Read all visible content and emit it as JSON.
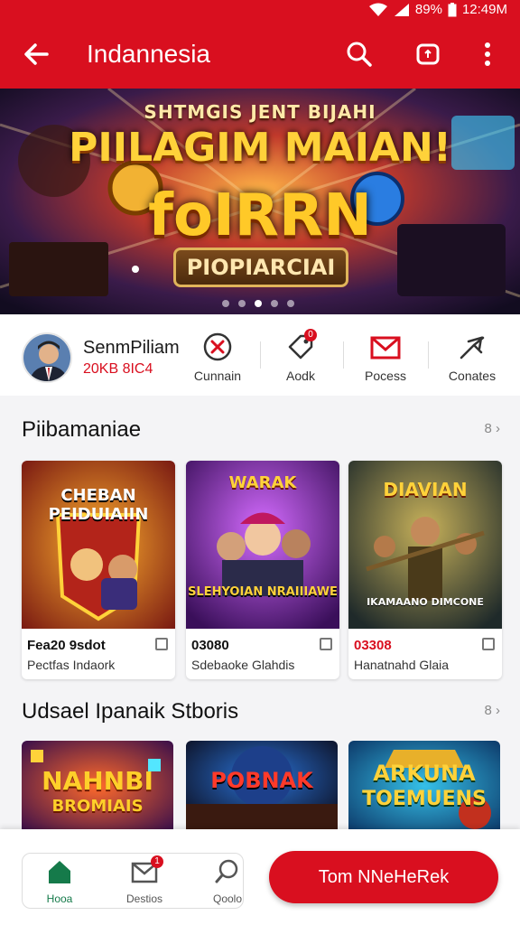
{
  "status_bar": {
    "battery": "89%",
    "time": "12:49M"
  },
  "app_bar": {
    "title": "Indannesia"
  },
  "banner": {
    "kicker": "SHTMGIS JENT BIJAHI",
    "title": "PIILAGIM MAIAN!",
    "logo": "foIRRN",
    "subtitle": "PIOPIARCIAI"
  },
  "profile": {
    "name": "SenmPiliam",
    "subtitle": "20KB 8IC4"
  },
  "quick_actions": [
    {
      "label": "Cunnain",
      "icon": "cancel-circle-icon"
    },
    {
      "label": "Aodk",
      "icon": "tag-icon",
      "badge": "0"
    },
    {
      "label": "Pocess",
      "icon": "mail-icon"
    },
    {
      "label": "Conates",
      "icon": "send-icon"
    }
  ],
  "section1": {
    "title": "Piibamaniae",
    "more": "8",
    "cards": [
      {
        "art_title": "CHEBAN PEIDUIAIIN",
        "line1": "Fea20 9sdot",
        "line2": "Pectfas Indaork"
      },
      {
        "art_title": "WARAK",
        "art_sub": "SLEHYOIAN NRAIIIAWE",
        "line1": "03080",
        "line2": "Sdebaoke Glahdis"
      },
      {
        "art_title": "DIAVIAN",
        "art_sub": "IKAMAANO DIMCONE",
        "line1": "03308",
        "line2": "Hanatnahd Glaia"
      }
    ]
  },
  "section2": {
    "title": "Udsael Ipanaik Stboris",
    "more": "8",
    "cards": [
      {
        "art_title": "NAHNBI",
        "art_sub": "BROMIAIS"
      },
      {
        "art_title": "POBNAK"
      },
      {
        "art_title": "ARKUNA",
        "art_sub": "TOEMUENS"
      }
    ]
  },
  "bottom_nav": {
    "items": [
      {
        "label": "Hooa",
        "icon": "home-icon"
      },
      {
        "label": "Destios",
        "icon": "mail-icon",
        "badge": "1"
      },
      {
        "label": "Qoolo",
        "icon": "search-icon"
      }
    ],
    "cta": "Tom NNeHeRek"
  },
  "colors": {
    "brand": "#d90f1f",
    "accent": "#ffd23a"
  }
}
